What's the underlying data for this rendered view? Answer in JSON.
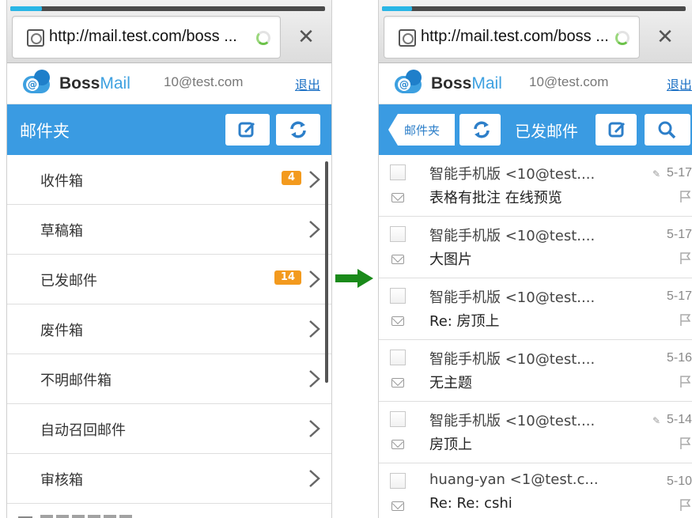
{
  "browser": {
    "url": "http://mail.test.com/boss ...",
    "load_progress": 0.1,
    "close_glyph": "✕"
  },
  "app": {
    "brand_boss": "Boss",
    "brand_mail": "Mail",
    "account": "10@test.com",
    "logout": "退出",
    "logo_at": "@"
  },
  "left": {
    "title": "邮件夹",
    "folders": [
      {
        "name": "收件箱",
        "count": "4"
      },
      {
        "name": "草稿箱",
        "count": ""
      },
      {
        "name": "已发邮件",
        "count": "14"
      },
      {
        "name": "废件箱",
        "count": ""
      },
      {
        "name": "不明邮件箱",
        "count": ""
      },
      {
        "name": "自动召回邮件",
        "count": ""
      },
      {
        "name": "审核箱",
        "count": ""
      }
    ]
  },
  "right": {
    "back_label": "邮件夹",
    "title": "已发邮件",
    "clip_glyph": "✎",
    "mails": [
      {
        "sender": "智能手机版 <10@test....",
        "subject": "表格有批注 在线预览",
        "date": "5-17",
        "attachment": true
      },
      {
        "sender": "智能手机版 <10@test....",
        "subject": "大图片",
        "date": "5-17",
        "attachment": false
      },
      {
        "sender": "智能手机版 <10@test....",
        "subject": "Re: 房顶上",
        "date": "5-17",
        "attachment": false
      },
      {
        "sender": "智能手机版 <10@test....",
        "subject": "无主题",
        "date": "5-16",
        "attachment": false
      },
      {
        "sender": "智能手机版 <10@test....",
        "subject": "房顶上",
        "date": "5-14",
        "attachment": true
      },
      {
        "sender": "huang-yan <1@test.c...",
        "subject": "Re: Re: cshi",
        "date": "5-10",
        "attachment": false
      }
    ]
  },
  "colors": {
    "accent_blue": "#3a9be2",
    "badge_orange": "#f39a1e",
    "arrow_green": "#1a8a1a"
  }
}
